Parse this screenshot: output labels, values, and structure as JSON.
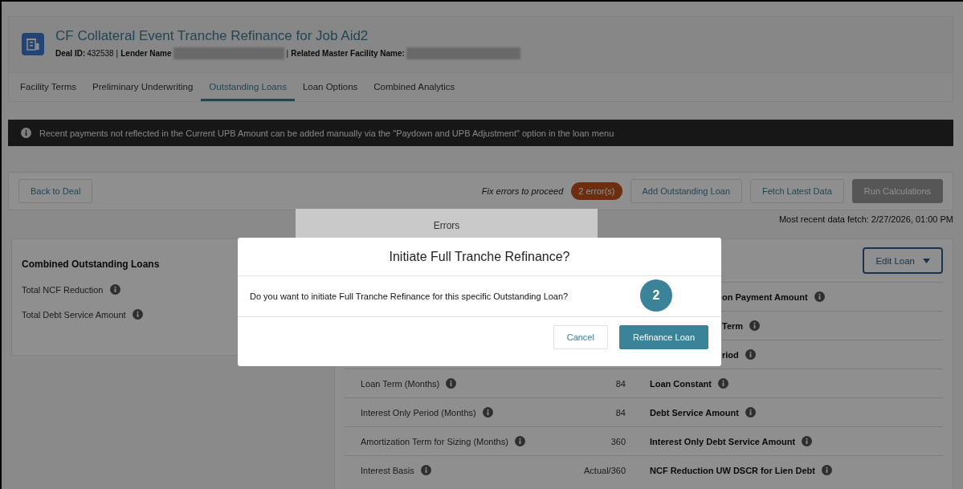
{
  "header": {
    "title": "CF Collateral Event Tranche Refinance for Job Aid2",
    "separator": "|",
    "meta": [
      {
        "label": "Deal ID:",
        "value": "432538",
        "redacted": false
      },
      {
        "label": "Lender Name",
        "redacted": true
      },
      {
        "label": "Related Master Facility Name:",
        "redacted": true
      }
    ]
  },
  "tabs": [
    {
      "label": "Facility Terms",
      "selected": false
    },
    {
      "label": "Preliminary Underwriting",
      "selected": false
    },
    {
      "label": "Outstanding Loans",
      "selected": true
    },
    {
      "label": "Loan Options",
      "selected": false
    },
    {
      "label": "Combined Analytics",
      "selected": false
    }
  ],
  "notice": "Recent payments not reflected in the Current UPB Amount can be added manually via the \"Paydown and UPB Adjustment\" option in the loan menu",
  "actions": {
    "back_button": "Back to Deal",
    "status_text": "Fix errors to proceed",
    "error_badge": "2 error(s)",
    "buttons": [
      {
        "label": "Add Outstanding Loan",
        "disabled": false
      },
      {
        "label": "Fetch Latest Data",
        "disabled": false
      },
      {
        "label": "Run Calculations",
        "disabled": true
      }
    ],
    "fetch_note": "Most recent data fetch: 2/27/2026, 01:00 PM"
  },
  "errors_popover": {
    "title": "Errors"
  },
  "summary": {
    "title": "Combined Outstanding Loans",
    "rows": [
      "Total NCF Reduction",
      "Total Debt Service Amount"
    ]
  },
  "loan_table": {
    "menu_button": "Edit Loan",
    "rows": [
      {
        "kind": "partial",
        "right_label": "on Payment Amount"
      },
      {
        "kind": "partial",
        "right_label": "Term"
      },
      {
        "kind": "partial",
        "right_label": "riod"
      },
      {
        "kind": "full",
        "label": "Loan Term (Months)",
        "value": "84",
        "right_label": "Loan Constant"
      },
      {
        "kind": "full",
        "label": "Interest Only Period (Months)",
        "value": "84",
        "right_label": "Debt Service Amount"
      },
      {
        "kind": "full",
        "label": "Amortization Term for Sizing (Months)",
        "value": "360",
        "right_label": "Interest Only Debt Service Amount"
      },
      {
        "kind": "full",
        "label": "Interest Basis",
        "value": "Actual/360",
        "right_label": "NCF Reduction UW DSCR for Lien Debt"
      }
    ]
  },
  "dialog": {
    "title": "Initiate Full Tranche Refinance?",
    "message": "Do you want to initiate Full Tranche Refinance for this specific Outstanding Loan?",
    "step_badge": "2",
    "buttons": [
      {
        "label": "Cancel",
        "kind": "secondary"
      },
      {
        "label": "Refinance Loan",
        "kind": "primary"
      }
    ]
  }
}
